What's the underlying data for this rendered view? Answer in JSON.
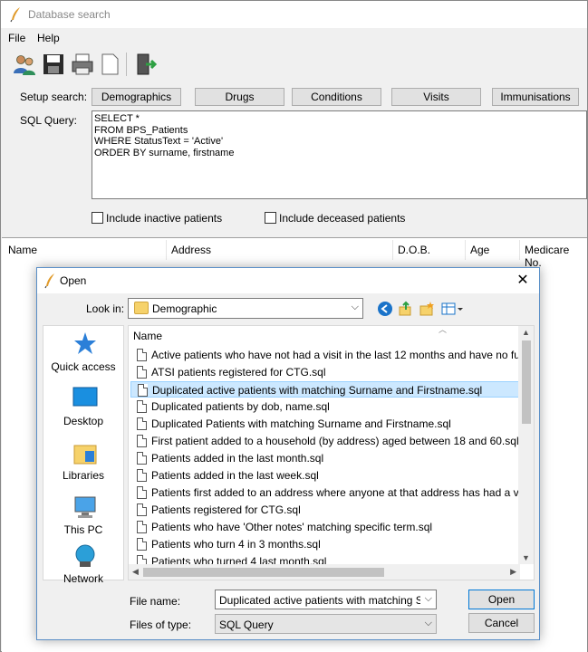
{
  "window": {
    "title": "Database search"
  },
  "menu": {
    "items": [
      "File",
      "Help"
    ]
  },
  "toolbar": {
    "icons": [
      "users-icon",
      "save-icon",
      "printer-icon",
      "new-document-icon",
      "exit-icon"
    ]
  },
  "setup": {
    "label": "Setup search:",
    "buttons": [
      "Demographics",
      "Drugs",
      "Conditions",
      "Visits",
      "Immunisations"
    ]
  },
  "sql": {
    "label": "SQL Query:",
    "lines": [
      "SELECT *",
      "FROM BPS_Patients",
      "WHERE StatusText = 'Active'",
      "ORDER BY surname, firstname"
    ]
  },
  "options": {
    "inactive": "Include inactive patients",
    "deceased": "Include deceased patients"
  },
  "results": {
    "columns": [
      "Name",
      "Address",
      "D.O.B.",
      "Age",
      "Medicare No."
    ]
  },
  "dialog": {
    "title": "Open",
    "look_in_label": "Look in:",
    "look_in_value": "Demographic",
    "places": [
      "Quick access",
      "Desktop",
      "Libraries",
      "This PC",
      "Network"
    ],
    "list_header": "Name",
    "files": [
      "Active patients who have not had a visit in the last 12 months and have no fut",
      "ATSI patients registered for CTG.sql",
      "Duplicated active patients with matching Surname and Firstname.sql",
      "Duplicated patients by dob, name.sql",
      "Duplicated Patients with matching Surname and Firstname.sql",
      "First patient added to a household (by address) aged between 18 and 60.sql",
      "Patients added in the last month.sql",
      "Patients added in the last week.sql",
      "Patients first added to an address where anyone at that address has had a visit",
      "Patients registered for CTG.sql",
      "Patients who have 'Other notes' matching specific term.sql",
      "Patients who turn 4 in 3 months.sql",
      "Patients who turned 4 last month.sql"
    ],
    "selected_index": 2,
    "file_name_label": "File name:",
    "file_name_value": "Duplicated active patients with matching Surna",
    "file_type_label": "Files of type:",
    "file_type_value": "SQL Query",
    "open_label": "Open",
    "cancel_label": "Cancel"
  },
  "colors": {
    "selection": "#cce8ff",
    "accent": "#0078d7"
  }
}
